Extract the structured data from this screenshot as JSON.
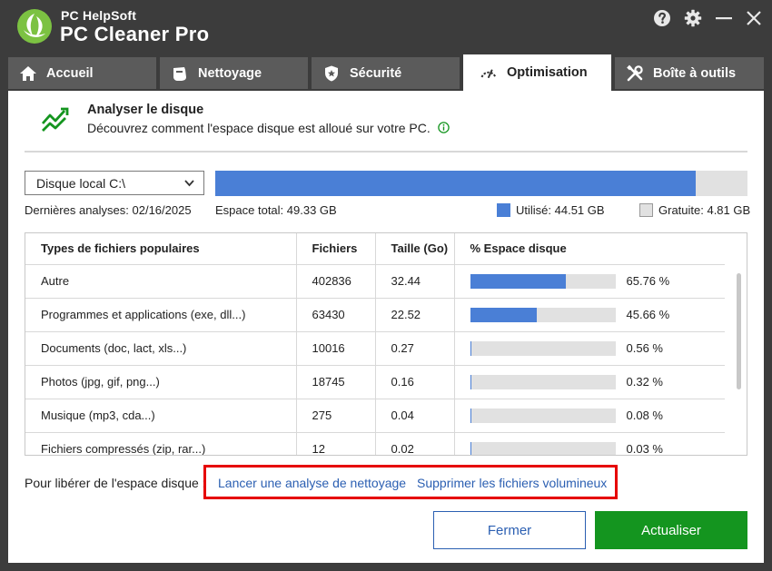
{
  "app": {
    "brand_small": "PC HelpSoft",
    "brand_name": "PC Cleaner Pro"
  },
  "window_controls": [
    "help-icon",
    "gear-icon",
    "minimize-icon",
    "close-icon"
  ],
  "tabs": [
    {
      "label": "Accueil",
      "icon": "home-icon"
    },
    {
      "label": "Nettoyage",
      "icon": "broom-icon"
    },
    {
      "label": "Sécurité",
      "icon": "shield-icon"
    },
    {
      "label": "Optimisation",
      "icon": "gauge-icon",
      "active": true
    },
    {
      "label": "Boîte à outils",
      "icon": "tools-icon"
    }
  ],
  "page": {
    "title": "Analyser le disque",
    "subtitle": "Découvrez comment l'espace disque est alloué sur votre PC."
  },
  "disk": {
    "selected": "Disque local C:\\",
    "used_fraction": 0.902,
    "last_scan": "Dernières analyses: 02/16/2025",
    "total": "Espace total: 49.33 GB",
    "used": "Utilisé: 44.51 GB",
    "free": "Gratuite: 4.81 GB",
    "used_color": "#4a7fd6",
    "free_color": "#e1e1e1"
  },
  "table": {
    "headers": [
      "Types de fichiers populaires",
      "Fichiers",
      "Taille (Go)",
      "% Espace disque"
    ],
    "rows": [
      {
        "type": "Autre",
        "files": "402836",
        "size": "32.44",
        "pct": "65.76 %",
        "pct_value": 65.76
      },
      {
        "type": "Programmes et applications (exe, dll...)",
        "files": "63430",
        "size": "22.52",
        "pct": "45.66 %",
        "pct_value": 45.66
      },
      {
        "type": "Documents (doc, lact, xls...)",
        "files": "10016",
        "size": "0.27",
        "pct": "0.56 %",
        "pct_value": 0.56
      },
      {
        "type": "Photos (jpg, gif, png...)",
        "files": "18745",
        "size": "0.16",
        "pct": "0.32 %",
        "pct_value": 0.32
      },
      {
        "type": "Musique (mp3, cda...)",
        "files": "275",
        "size": "0.04",
        "pct": "0.08 %",
        "pct_value": 0.08
      },
      {
        "type": "Fichiers compressés (zip, rar...)",
        "files": "12",
        "size": "0.02",
        "pct": "0.03 %",
        "pct_value": 0.03
      }
    ]
  },
  "footer": {
    "free_label": "Pour libérer de l'espace disque :",
    "link_scan": "Lancer une analyse de nettoyage",
    "link_large": "Supprimer les fichiers volumineux",
    "close_button": "Fermer",
    "update_button": "Actualiser"
  }
}
